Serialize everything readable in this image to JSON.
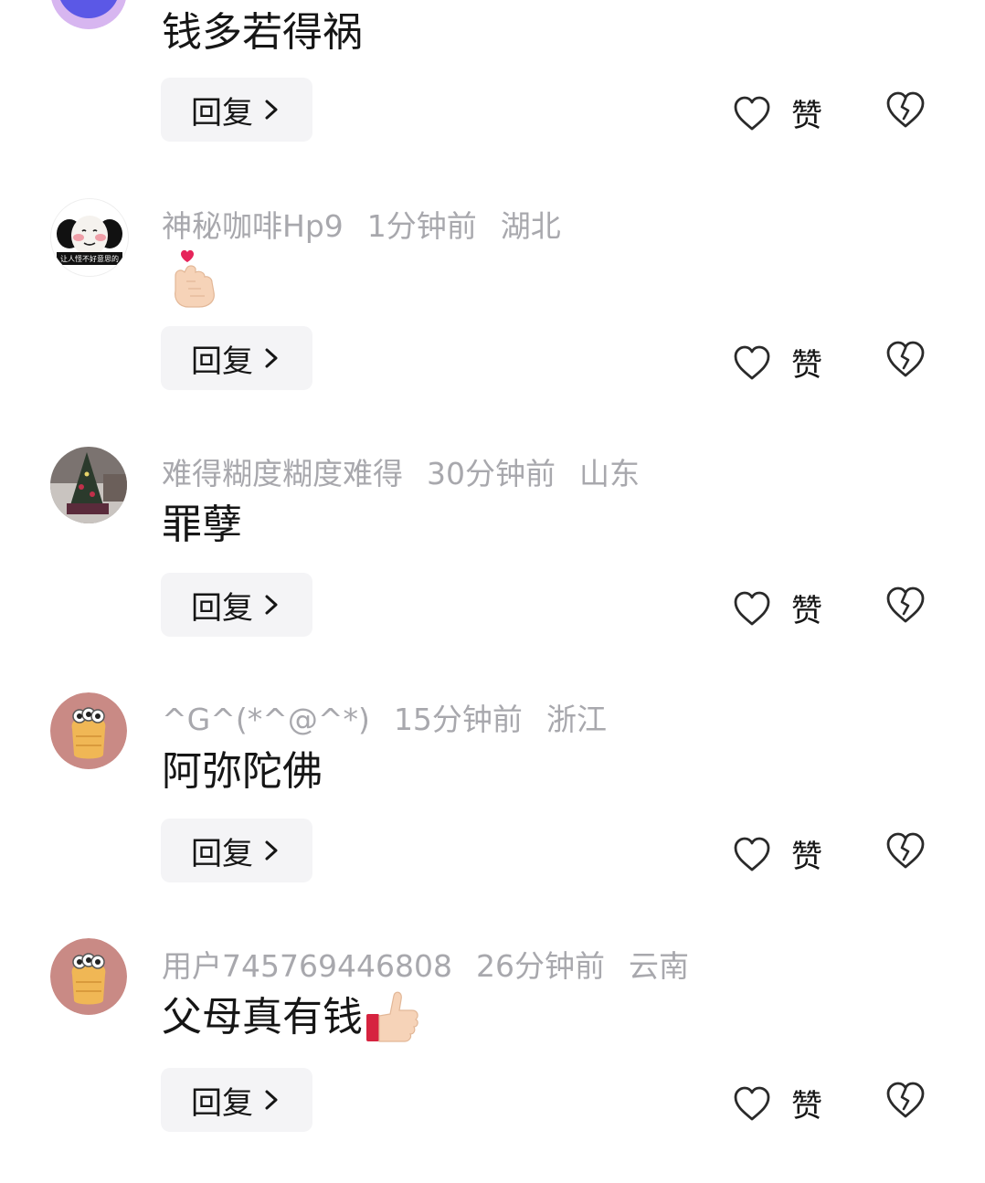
{
  "comments": [
    {
      "user": "",
      "time": "",
      "region": "",
      "text": "钱多若得祸",
      "avatar": "purple-avatar"
    },
    {
      "user": "神秘咖啡Hp9",
      "time": "1分钟前",
      "region": "湖北",
      "text": "",
      "avatar": "panda-meme-avatar",
      "sticker_text": "让人怪不好意思的"
    },
    {
      "user": "难得糊度糊度难得",
      "time": "30分钟前",
      "region": "山东",
      "text": "罪孽",
      "avatar": "christmas-tree-avatar"
    },
    {
      "user": "^G^(*^@^*)",
      "time": "15分钟前",
      "region": "浙江",
      "text": "阿弥陀佛",
      "avatar": "bread-creature-avatar"
    },
    {
      "user": "用户745769446808",
      "time": "26分钟前",
      "region": "云南",
      "text": "父母真有钱",
      "avatar": "bread-creature-avatar"
    }
  ],
  "labels": {
    "reply": "回复",
    "like": "赞"
  },
  "icons": {
    "heart": "heart-outline-icon",
    "broken_heart": "broken-heart-icon",
    "chevron": "chevron-right-icon",
    "finger_heart": "finger-heart-emoji",
    "thumbs_up": "thumbs-up-emoji"
  },
  "colors": {
    "meta": "#a8a8ad",
    "text": "#161616",
    "button_bg": "#f4f4f6"
  }
}
